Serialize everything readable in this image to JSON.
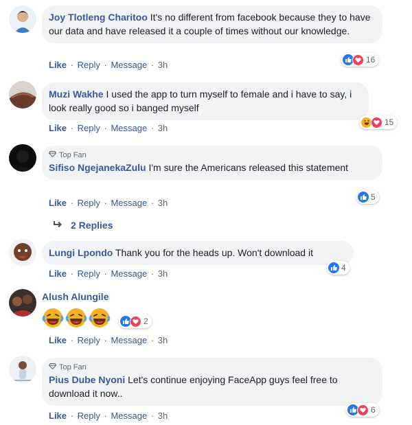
{
  "actions": {
    "like": "Like",
    "reply": "Reply",
    "message": "Message",
    "sep": "·"
  },
  "colors": {
    "name": "#385898",
    "bubble": "#f2f3f5",
    "meta": "#606770",
    "like_icon": "#2078f4",
    "love_icon": "#f33e58",
    "haha_icon": "#f7b125"
  },
  "comments": [
    {
      "name": "Joy Tlotleng Charitoo",
      "text": "It's no different from facebook because they to have our data and have released it a couple of times without our knowledge.",
      "time": "3h",
      "reactions": [
        "like-icon",
        "love-icon"
      ],
      "count": "16"
    },
    {
      "name": "Muzi Wakhe",
      "text": "I used the app to turn myself to female and i have to say, i look really good so i banged myself",
      "time": "3h",
      "reactions": [
        "haha-icon",
        "love-icon"
      ],
      "count": "15"
    },
    {
      "badge": "Top Fan",
      "name": "Sifiso NgejanekaZulu",
      "text": "I'm sure the Americans released this statement",
      "time": "3h",
      "reactions": [
        "like-icon"
      ],
      "count": "5"
    },
    {
      "name": "Lungi Lpondo",
      "text": "Thank you for the heads up. Won't download it",
      "time": "3h",
      "reactions": [
        "like-icon"
      ],
      "count": "4"
    },
    {
      "name": "Alush Alungile",
      "emojis": [
        "laughing-tears-emoji",
        "laughing-tears-emoji",
        "laughing-tears-emoji"
      ],
      "time": "3h",
      "reactions": [
        "like-icon",
        "love-icon"
      ],
      "count": "2"
    },
    {
      "badge": "Top Fan",
      "name": "Pius Dube Nyoni",
      "text": "Let's continue enjoying FaceApp guys feel free to download it now..",
      "time": "3h",
      "reactions": [
        "like-icon",
        "love-icon"
      ],
      "count": "6"
    }
  ],
  "replies_link": "2 Replies"
}
